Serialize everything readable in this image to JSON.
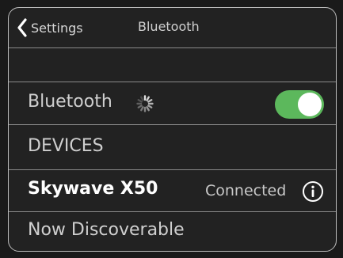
{
  "nav": {
    "back_label": "Settings",
    "title": "Bluetooth"
  },
  "bluetooth": {
    "label": "Bluetooth",
    "enabled": true,
    "toggle_color": "#5cb85c"
  },
  "devices": {
    "header": "DEVICES",
    "items": [
      {
        "name": "Skywave X50",
        "status": "Connected",
        "icon": "info-icon"
      }
    ]
  },
  "discoverable": {
    "label": "Now Discoverable"
  }
}
